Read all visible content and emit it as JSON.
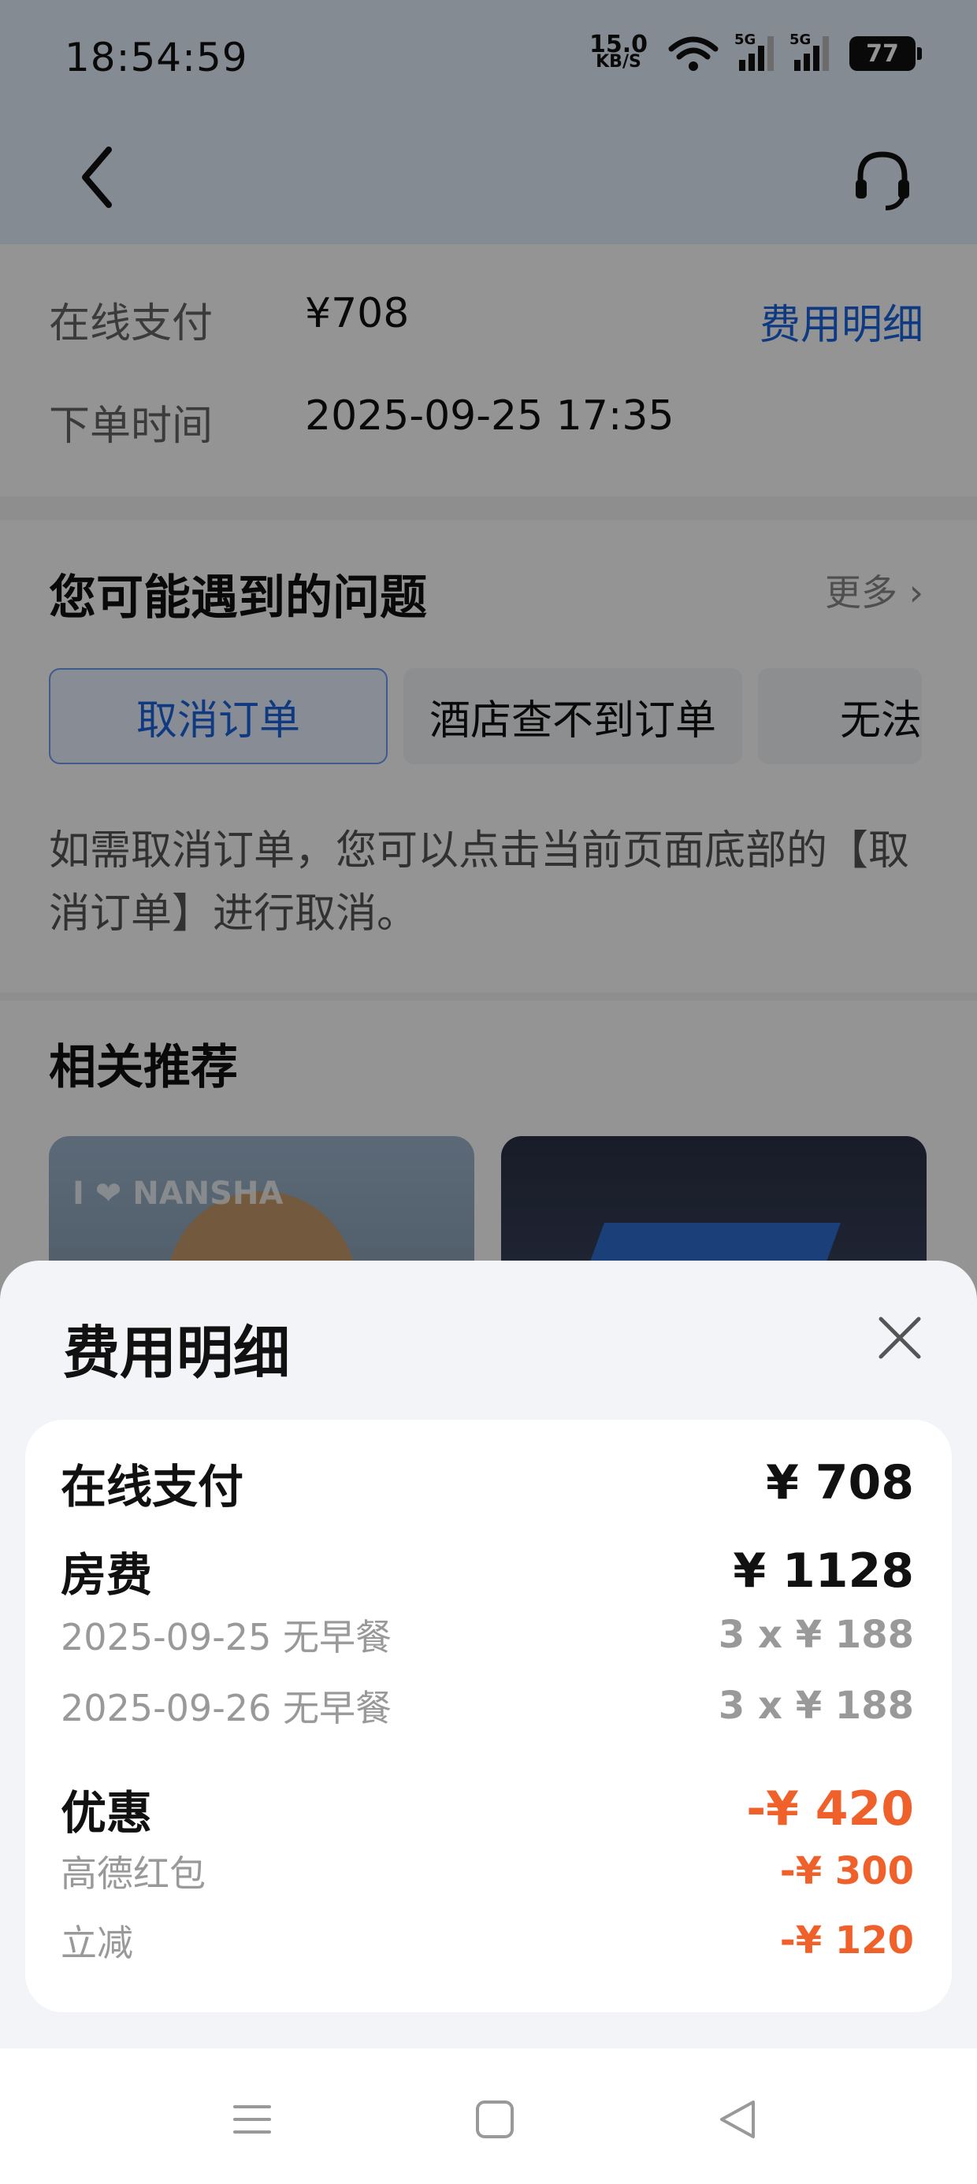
{
  "status_bar": {
    "time": "18:54:59",
    "net_speed_value": "15.0",
    "net_speed_unit": "KB/S",
    "signal1_label": "5G",
    "signal2_label": "5G",
    "battery": "77"
  },
  "nav": {
    "back_icon": "chevron-left-icon",
    "service_icon": "headset-icon"
  },
  "order_info": {
    "rows": [
      {
        "label": "在线支付",
        "value": "¥708"
      },
      {
        "label": "下单时间",
        "value": "2025-09-25 17:35"
      }
    ],
    "fee_link": "费用明细"
  },
  "problems": {
    "title": "您可能遇到的问题",
    "more": "更多",
    "chips": [
      "取消订单",
      "酒店查不到订单",
      "无法"
    ],
    "description": "如需取消订单，您可以点击当前页面底部的【取消订单】进行取消。"
  },
  "recommend": {
    "title": "相关推荐",
    "img1_text": "I ❤ NANSHA"
  },
  "fee_sheet": {
    "title": "费用明细",
    "online_pay": {
      "label": "在线支付",
      "amount": "¥ 708"
    },
    "room_fee": {
      "label": "房费",
      "amount": "¥ 1128"
    },
    "room_items": [
      {
        "label": "2025-09-25 无早餐",
        "amount": "3 x ¥ 188"
      },
      {
        "label": "2025-09-26 无早餐",
        "amount": "3 x ¥ 188"
      }
    ],
    "discount": {
      "label": "优惠",
      "amount": "-¥ 420"
    },
    "discount_items": [
      {
        "label": "高德红包",
        "amount": "-¥ 300"
      },
      {
        "label": "立减",
        "amount": "-¥ 120"
      }
    ],
    "accent_color": "#f0602a"
  },
  "system_nav": {
    "menu_icon": "menu-icon",
    "home_icon": "home-square-icon",
    "back_icon": "back-triangle-icon"
  }
}
